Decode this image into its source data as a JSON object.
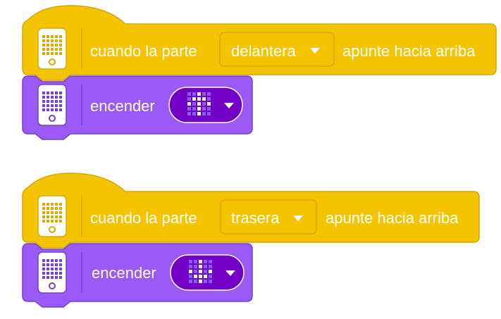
{
  "colors": {
    "event_block": "#f5c400",
    "event_border": "#d3a800",
    "action_block": "#9b59f6",
    "action_border": "#7a3fd2",
    "hub_icon_panel": "#ffffff",
    "hub_icon_pixels_event": "#d8aa00",
    "hub_icon_pixels_action": "#7a3fd2",
    "image_picker_bg": "#7400c8",
    "image_pixel_off": "#8a5cff",
    "image_pixel_on": "#ffffff"
  },
  "scripts": [
    {
      "event": {
        "prefix": "cuando la  parte",
        "face_dropdown": "delantera",
        "suffix": "apunte hacia arriba",
        "hub_icon": "hub-icon"
      },
      "action": {
        "label": "encender",
        "image": "arrow-up-pattern",
        "hub_icon": "hub-icon"
      }
    },
    {
      "event": {
        "prefix": "cuando la  parte",
        "face_dropdown": "trasera",
        "suffix": "apunte hacia arriba",
        "hub_icon": "hub-icon"
      },
      "action": {
        "label": "encender",
        "image": "arrow-down-pattern",
        "hub_icon": "hub-icon"
      }
    }
  ]
}
